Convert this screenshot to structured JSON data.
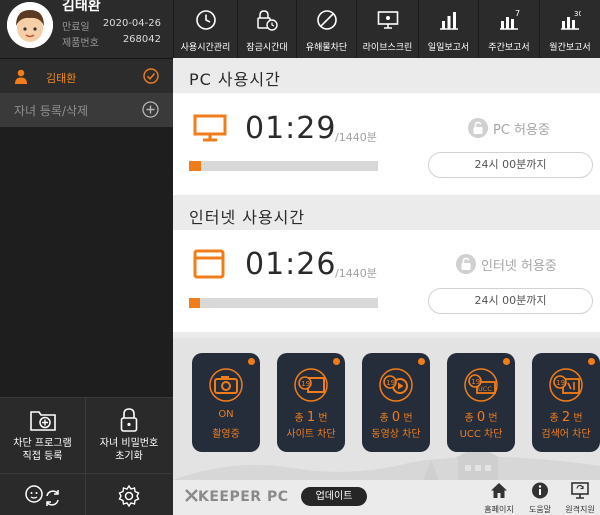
{
  "profile": {
    "name": "김태환",
    "expiry_label": "만료일",
    "expiry_value": "2020-04-26",
    "product_label": "제품번호",
    "product_value": "268042"
  },
  "sidebar": {
    "child_name": "김태환",
    "register_label": "자녀 등록/삭제",
    "bottom_buttons": [
      {
        "line1": "차단 프로그램",
        "line2": "직접 등록"
      },
      {
        "line1": "자녀 비밀번호",
        "line2": "초기화"
      }
    ]
  },
  "toolbar": {
    "items": [
      {
        "label": "사용시간관리",
        "icon": "clock-icon"
      },
      {
        "label": "잠금시간대",
        "icon": "lock-clock-icon"
      },
      {
        "label": "유해물차단",
        "icon": "block-icon"
      },
      {
        "label": "라이브스크린",
        "icon": "monitor-icon"
      },
      {
        "label": "일일보고서",
        "icon": "daily-report-icon"
      },
      {
        "label": "주간보고서",
        "icon": "weekly-report-icon"
      },
      {
        "label": "월간보고서",
        "icon": "monthly-report-icon"
      }
    ],
    "weekly_badge": "7",
    "monthly_badge": "30"
  },
  "pc_usage": {
    "title": "PC 사용시간",
    "time": "01:29",
    "total": "/1440분",
    "progress": 0.062,
    "status": "PC 허용중",
    "until": "24시 00분까지"
  },
  "internet_usage": {
    "title": "인터넷 사용시간",
    "time": "01:26",
    "total": "/1440분",
    "progress": 0.06,
    "status": "인터넷 허용중",
    "until": "24시 00분까지"
  },
  "tiles": [
    {
      "line1": "ON",
      "line2": "촬영중",
      "icon": "camera-icon"
    },
    {
      "prefix": "총",
      "count": "1",
      "suffix": "번",
      "line2": "사이트 차단",
      "icon": "site-block-icon"
    },
    {
      "prefix": "총",
      "count": "0",
      "suffix": "번",
      "line2": "동영상 차단",
      "icon": "video-block-icon"
    },
    {
      "prefix": "총",
      "count": "0",
      "suffix": "번",
      "line2": "UCC 차단",
      "icon": "ucc-block-icon"
    },
    {
      "prefix": "총",
      "count": "2",
      "suffix": "번",
      "line2": "검색어 차단",
      "icon": "search-word-block-icon"
    }
  ],
  "footer": {
    "brand": "KEEPER PC",
    "update": "업데이트",
    "home": "홈페이지",
    "help": "도움말",
    "remote": "원격지원"
  },
  "colors": {
    "accent": "#f07d1a",
    "sidebar": "#1e1e1e",
    "toolbar": "#2b2b2b",
    "tile": "#252d3a"
  }
}
